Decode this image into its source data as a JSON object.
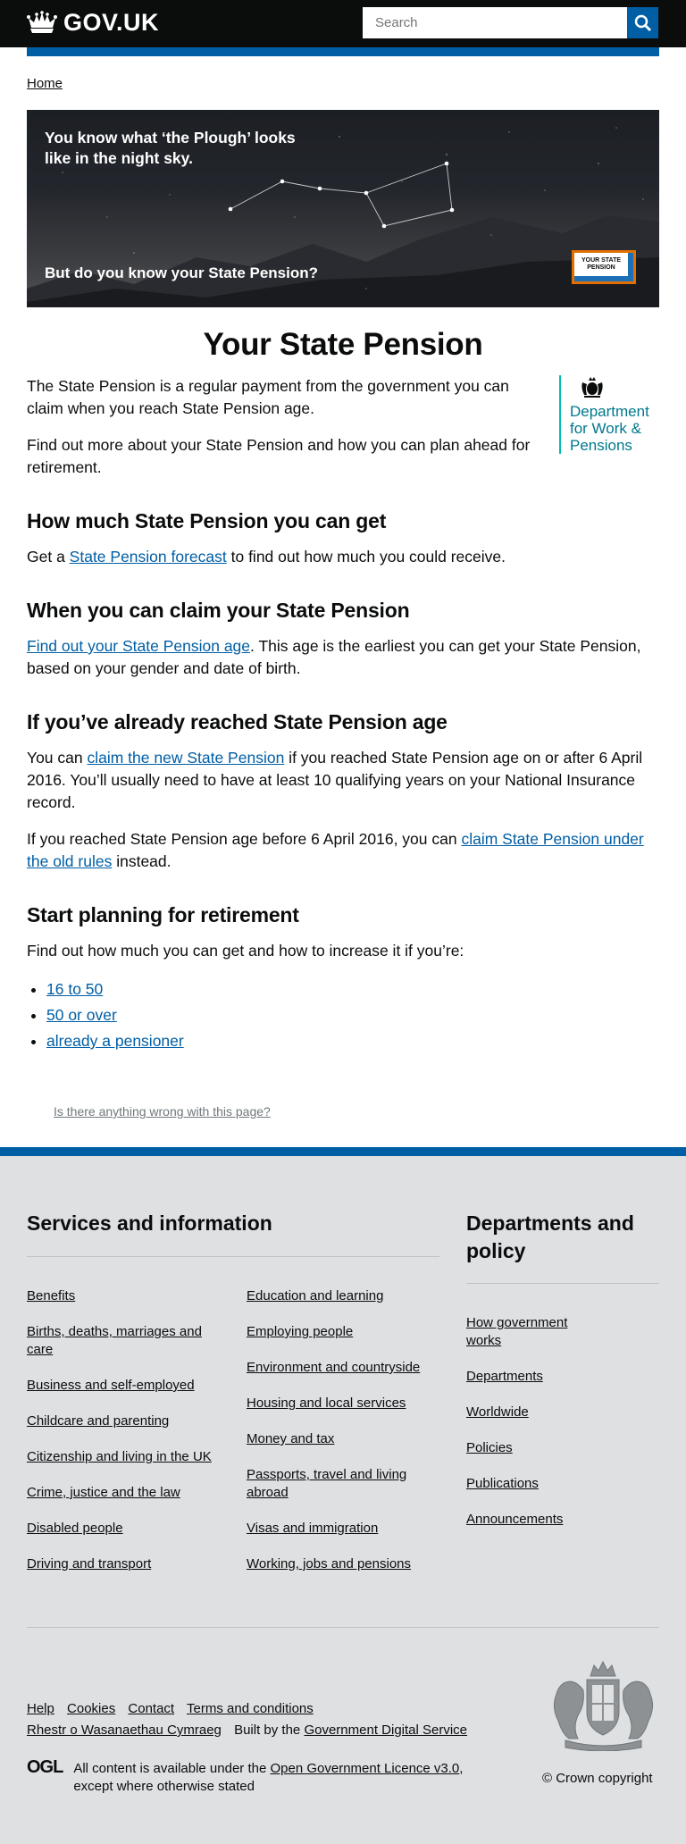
{
  "header": {
    "logo_text": "GOV.UK",
    "search_placeholder": "Search"
  },
  "breadcrumb": {
    "home": "Home"
  },
  "hero": {
    "top_text": "You know what ‘the Plough’ looks like in the night sky.",
    "bottom_text": "But do you know your State Pension?",
    "badge_line1": "YOUR STATE",
    "badge_line2": "PENSION"
  },
  "page_title": "Your State Pension",
  "intro": {
    "p1": "The State Pension is a regular payment from the government you can claim when you reach State Pension age.",
    "p2": "Find out more about your State Pension and how you can plan ahead for retirement."
  },
  "dwp": {
    "line1": "Department",
    "line2": "for Work &",
    "line3": "Pensions"
  },
  "sections": {
    "how_much": {
      "heading": "How much State Pension you can get",
      "pre": "Get a ",
      "link": "State Pension forecast",
      "post": " to find out how much you could receive."
    },
    "when": {
      "heading": "When you can claim your State Pension",
      "link": "Find out your State Pension age",
      "post": ". This age is the earliest you can get your State Pension, based on your gender and date of birth."
    },
    "reached": {
      "heading": "If you’ve already reached State Pension age",
      "p1_pre": "You can ",
      "p1_link": "claim the new State Pension",
      "p1_post": " if you reached State Pension age on or after 6 April 2016. You’ll usually need to have at least 10 qualifying years on your National Insurance record.",
      "p2_pre": "If you reached State Pension age before 6 April 2016, you can ",
      "p2_link": "claim State Pension under the old rules",
      "p2_post": " instead."
    },
    "planning": {
      "heading": "Start planning for retirement",
      "intro": "Find out how much you can get and how to increase it if you’re:",
      "links": [
        "16 to 50",
        "50 or over",
        "already a pensioner"
      ]
    }
  },
  "report_link": "Is there anything wrong with this page?",
  "footer": {
    "services_title": "Services and information",
    "departments_title": "Departments and policy",
    "services_col1": [
      "Benefits",
      "Births, deaths, marriages and care",
      "Business and self-employed",
      "Childcare and parenting",
      "Citizenship and living in the UK",
      "Crime, justice and the law",
      "Disabled people",
      "Driving and transport"
    ],
    "services_col2": [
      "Education and learning",
      "Employing people",
      "Environment and countryside",
      "Housing and local services",
      "Money and tax",
      "Passports, travel and living abroad",
      "Visas and immigration",
      "Working, jobs and pensions"
    ],
    "departments": [
      "How government works",
      "Departments",
      "Worldwide",
      "Policies",
      "Publications",
      "Announcements"
    ],
    "meta": [
      "Help",
      "Cookies",
      "Contact",
      "Terms and conditions"
    ],
    "meta_welsh": "Rhestr o Wasanaethau Cymraeg",
    "built_by_pre": "Built by the ",
    "built_by_link": "Government Digital Service",
    "ogl": "OGL",
    "licence_pre": "All content is available under the ",
    "licence_link": "Open Government Licence v3.0",
    "licence_post": ", except where otherwise stated",
    "copyright": "© Crown copyright"
  }
}
